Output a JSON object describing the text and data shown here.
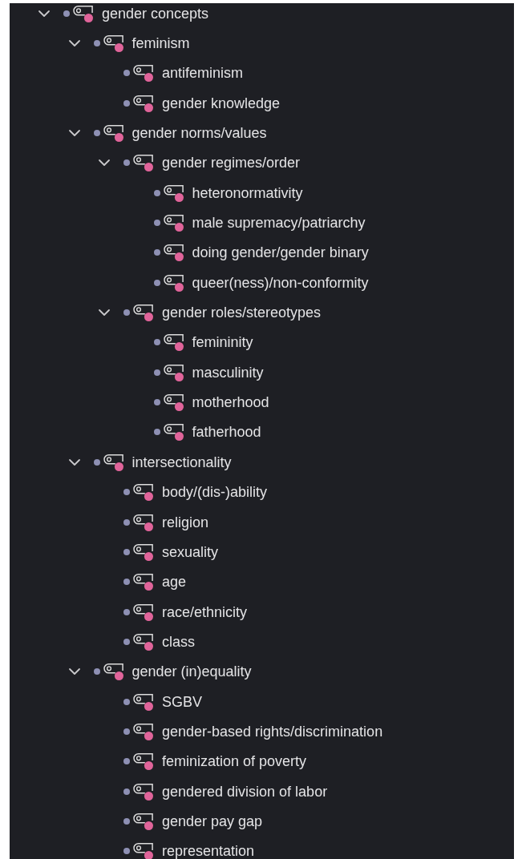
{
  "tree": [
    {
      "label": "gender concepts",
      "expanded": true,
      "children": [
        {
          "label": "feminism",
          "expanded": true,
          "children": [
            {
              "label": "antifeminism"
            },
            {
              "label": "gender knowledge"
            }
          ]
        },
        {
          "label": "gender norms/values",
          "expanded": true,
          "children": [
            {
              "label": "gender regimes/order",
              "expanded": true,
              "children": [
                {
                  "label": "heteronormativity"
                },
                {
                  "label": "male supremacy/patriarchy"
                },
                {
                  "label": "doing gender/gender binary"
                },
                {
                  "label": "queer(ness)/non-conformity"
                }
              ]
            },
            {
              "label": "gender roles/stereotypes",
              "expanded": true,
              "children": [
                {
                  "label": "femininity"
                },
                {
                  "label": "masculinity"
                },
                {
                  "label": "motherhood"
                },
                {
                  "label": "fatherhood"
                }
              ]
            }
          ]
        },
        {
          "label": "intersectionality",
          "expanded": true,
          "children": [
            {
              "label": "body/(dis-)ability"
            },
            {
              "label": "religion"
            },
            {
              "label": "sexuality"
            },
            {
              "label": "age"
            },
            {
              "label": "race/ethnicity"
            },
            {
              "label": "class"
            }
          ]
        },
        {
          "label": "gender (in)equality",
          "expanded": true,
          "children": [
            {
              "label": "SGBV"
            },
            {
              "label": "gender-based rights/discrimination"
            },
            {
              "label": "feminization of poverty"
            },
            {
              "label": "gendered division of labor"
            },
            {
              "label": "gender pay gap"
            },
            {
              "label": "representation"
            }
          ]
        }
      ]
    }
  ]
}
